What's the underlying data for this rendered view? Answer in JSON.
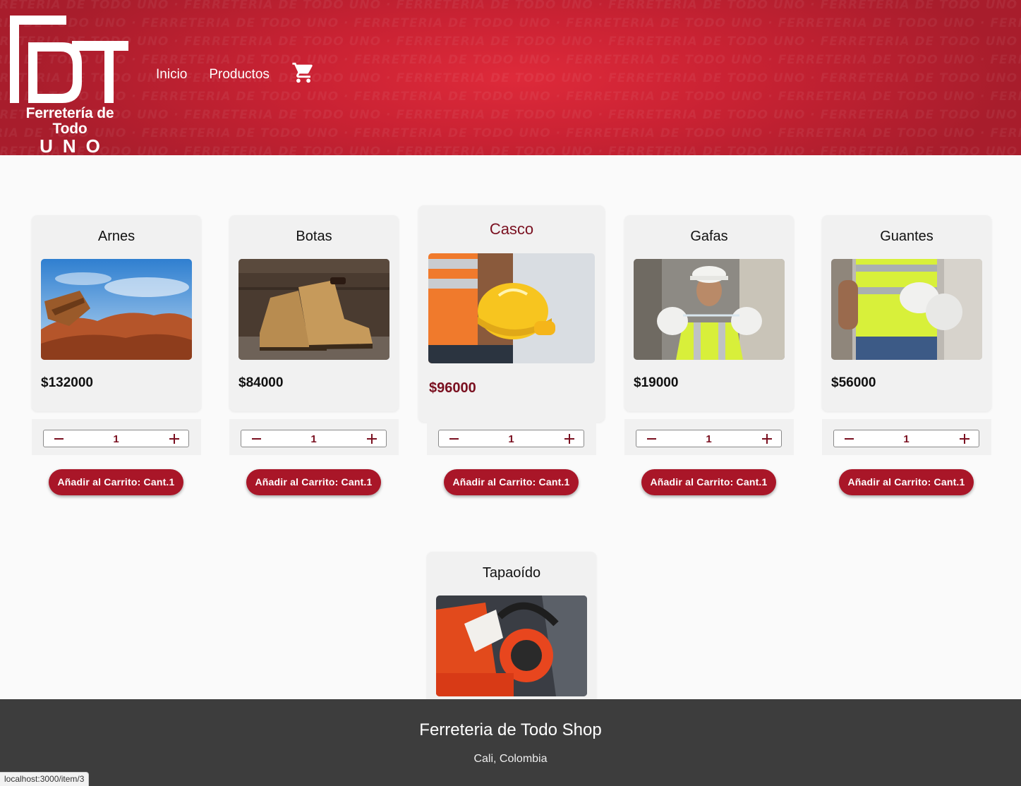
{
  "header": {
    "bg_pattern_text": "FERRETERIA DE TODO UNO ·",
    "logo": {
      "line1": "Ferretería de Todo",
      "line2": "UNO"
    },
    "nav": {
      "home": "Inicio",
      "products": "Productos"
    },
    "cart_icon": "shopping-cart-icon"
  },
  "products": [
    {
      "name": "Arnes",
      "price": "$132000",
      "qty": "1",
      "button": "Añadir al Carrito: Cant.1"
    },
    {
      "name": "Botas",
      "price": "$84000",
      "qty": "1",
      "button": "Añadir al Carrito: Cant.1"
    },
    {
      "name": "Casco",
      "price": "$96000",
      "qty": "1",
      "button": "Añadir al Carrito: Cant.1"
    },
    {
      "name": "Gafas",
      "price": "$19000",
      "qty": "1",
      "button": "Añadir al Carrito: Cant.1"
    },
    {
      "name": "Guantes",
      "price": "$56000",
      "qty": "1",
      "button": "Añadir al Carrito: Cant.1"
    },
    {
      "name": "Tapaoído"
    }
  ],
  "footer": {
    "title": "Ferreteria de Todo Shop",
    "subtitle": "Cali, Colombia"
  },
  "status_bar": {
    "url": "localhost:3000/item/3"
  },
  "colors": {
    "brand_red": "#c92233",
    "button_red": "#a91628",
    "accent_text": "#7a1020",
    "footer_bg": "#3d3d3d"
  }
}
